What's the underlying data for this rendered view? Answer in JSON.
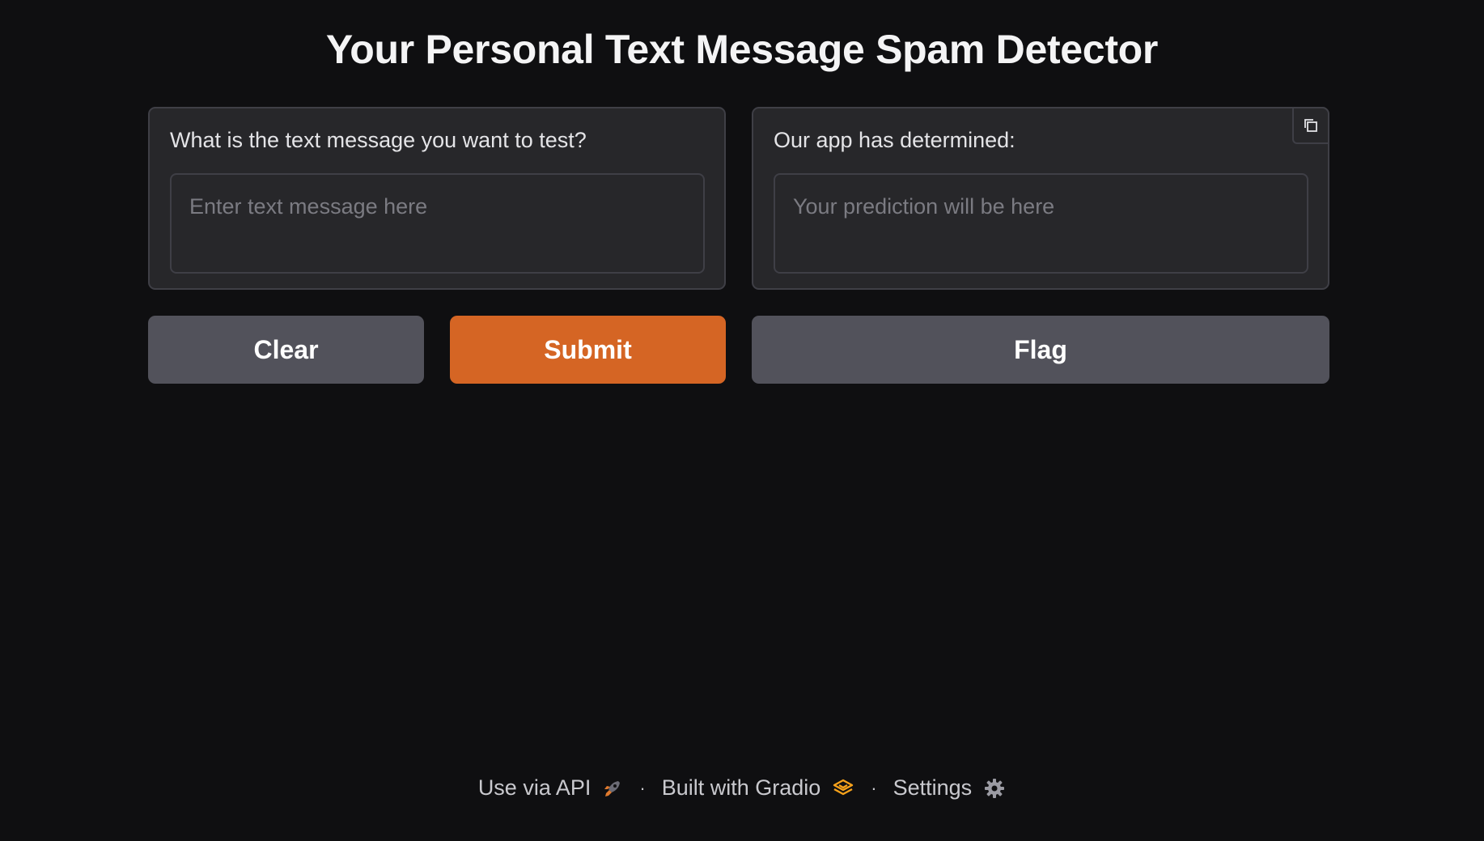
{
  "header": {
    "title": "Your Personal Text Message Spam Detector"
  },
  "input_panel": {
    "label": "What is the text message you want to test?",
    "value": "",
    "placeholder": "Enter text message here"
  },
  "output_panel": {
    "label": "Our app has determined:",
    "value": "",
    "placeholder": "Your prediction will be here",
    "copy_icon": "copy-icon"
  },
  "buttons": {
    "clear_label": "Clear",
    "submit_label": "Submit",
    "flag_label": "Flag"
  },
  "footer": {
    "api_label": "Use via API",
    "api_icon": "rocket-icon",
    "separator": "·",
    "gradio_label": "Built with Gradio",
    "gradio_icon": "gradio-logo-icon",
    "settings_label": "Settings",
    "settings_icon": "gear-icon"
  },
  "colors": {
    "background": "#0f0f11",
    "panel": "#27272a",
    "border": "#3f3f46",
    "primary": "#d56524",
    "secondary": "#52525b",
    "gradio_accent": "#f7a21b"
  }
}
